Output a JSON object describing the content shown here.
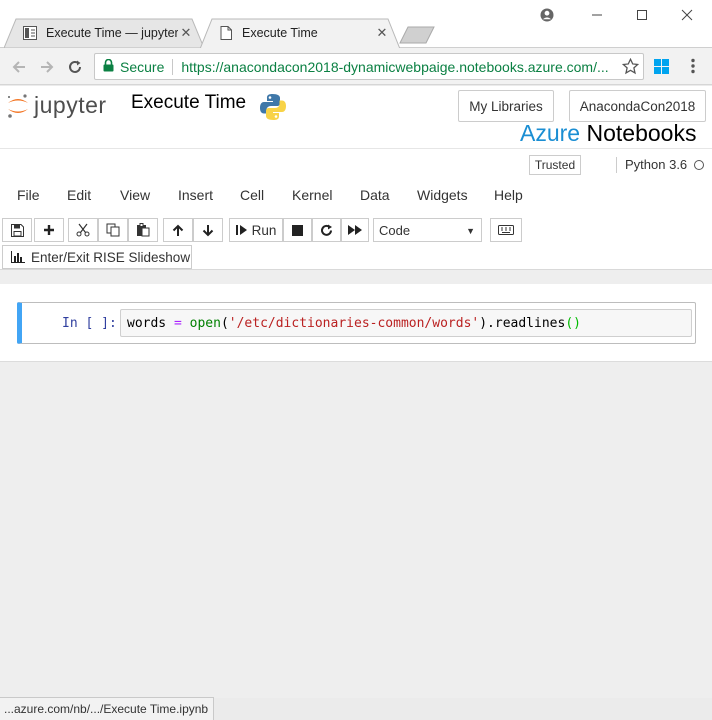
{
  "browser": {
    "tabs": [
      {
        "label": "Execute Time — jupyter_",
        "icon": "book-icon",
        "active": false
      },
      {
        "label": "Execute Time",
        "icon": "document-icon",
        "active": true
      }
    ],
    "security_label": "Secure",
    "url": "https://anacondacon2018-dynamicwebpaige.notebooks.azure.com/...",
    "status_url": "...azure.com/nb/.../Execute Time.ipynb"
  },
  "jupyter": {
    "logo_text": "jupyter",
    "notebook_title": "Execute Time",
    "my_libraries_label": "My Libraries",
    "library_name": "AnacondaCon2018",
    "azure_word": "Azure",
    "notebooks_word": "Notebooks",
    "trusted_label": "Trusted",
    "kernel_name": "Python 3.6",
    "menu": [
      "File",
      "Edit",
      "View",
      "Insert",
      "Cell",
      "Kernel",
      "Data",
      "Widgets",
      "Help"
    ],
    "run_label": "Run",
    "cell_type": "Code",
    "rise_label": "Enter/Exit RISE Slideshow"
  },
  "cell": {
    "prompt": "In [ ]:",
    "code_tokens": {
      "var": "words",
      "op": " = ",
      "fn": "open",
      "open_paren": "(",
      "str": "'/etc/dictionaries-common/words'",
      "close_paren": ")",
      "method": ".readlines",
      "call": "()"
    }
  },
  "colors": {
    "accent_blue": "#1a8ed3",
    "cell_edit_border": "#42a5f5",
    "secure_green": "#0b8043",
    "jupyter_orange": "#f37726"
  }
}
